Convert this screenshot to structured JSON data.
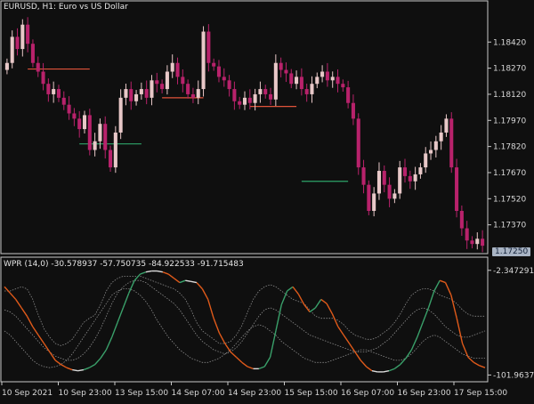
{
  "chart_data": [
    {
      "type": "candlestick",
      "symbol": "EURUSD",
      "timeframe": "H1",
      "description": "Euro vs US Dollar",
      "title_text": "EURUSD, H1:  Euro vs US Dollar",
      "y_ticks": [
        "1.18420",
        "1.18270",
        "1.18120",
        "1.17970",
        "1.17820",
        "1.17670",
        "1.17520",
        "1.17370"
      ],
      "current_price": "1.17250",
      "ylim": [
        1.1722,
        1.1859
      ],
      "closes": [
        1.183,
        1.1845,
        1.1838,
        1.1852,
        1.1841,
        1.183,
        1.1825,
        1.1818,
        1.1812,
        1.1815,
        1.181,
        1.1806,
        1.1801,
        1.1798,
        1.1792,
        1.18,
        1.178,
        1.1785,
        1.1795,
        1.178,
        1.177,
        1.179,
        1.181,
        1.1815,
        1.1808,
        1.1812,
        1.1815,
        1.181,
        1.182,
        1.1818,
        1.1815,
        1.1825,
        1.183,
        1.1822,
        1.1818,
        1.1812,
        1.181,
        1.1815,
        1.1848,
        1.183,
        1.1828,
        1.1822,
        1.182,
        1.1815,
        1.1808,
        1.1806,
        1.181,
        1.1807,
        1.1812,
        1.1815,
        1.1812,
        1.1809,
        1.183,
        1.1826,
        1.1824,
        1.1818,
        1.1822,
        1.1815,
        1.1812,
        1.1818,
        1.1822,
        1.1825,
        1.182,
        1.1822,
        1.1818,
        1.1816,
        1.1807,
        1.1798,
        1.177,
        1.176,
        1.1745,
        1.1755,
        1.1768,
        1.176,
        1.1752,
        1.1755,
        1.177,
        1.1765,
        1.1762,
        1.1766,
        1.177,
        1.1778,
        1.178,
        1.1785,
        1.179,
        1.1798,
        1.177,
        1.1745,
        1.1735,
        1.1728,
        1.1726,
        1.1729,
        1.1725
      ],
      "levels": [
        {
          "price": 1.18265,
          "color": "#e0533a",
          "start_bar": 4,
          "end_bar": 16
        },
        {
          "price": 1.17835,
          "color": "#2fa56a",
          "start_bar": 14,
          "end_bar": 26
        },
        {
          "price": 1.181,
          "color": "#e0533a",
          "start_bar": 30,
          "end_bar": 38
        },
        {
          "price": 1.1805,
          "color": "#e0533a",
          "start_bar": 47,
          "end_bar": 56
        },
        {
          "price": 1.1762,
          "color": "#2fa56a",
          "start_bar": 57,
          "end_bar": 66
        }
      ],
      "colors": {
        "bull": "#e8c8c8",
        "bear": "#b8226b",
        "current_bg": "#a9b4c4"
      }
    },
    {
      "type": "line",
      "name": "WPR (14,0)",
      "values_text": [
        "-30.578937",
        "-57.750735",
        "-84.922533",
        "-91.715483"
      ],
      "y_ticks": [
        "-2.347291",
        "-101.96374"
      ],
      "ylim": [
        -105,
        0
      ],
      "x_labels": [
        "10 Sep 2021",
        "10 Sep 23:00",
        "13 Sep 15:00",
        "14 Sep 07:00",
        "14 Sep 23:00",
        "15 Sep 15:00",
        "16 Sep 07:00",
        "16 Sep 23:00",
        "17 Sep 15:00"
      ],
      "series": [
        {
          "values": [
            -18,
            -24,
            -30,
            -38,
            -46,
            -56,
            -64,
            -72,
            -80,
            -88,
            -92,
            -95,
            -97,
            -98,
            -97,
            -95,
            -92,
            -86,
            -78,
            -66,
            -52,
            -38,
            -24,
            -12,
            -6,
            -4,
            -3,
            -3,
            -4,
            -6,
            -10,
            -14,
            -12,
            -13,
            -14,
            -20,
            -30,
            -48,
            -62,
            -72,
            -80,
            -85,
            -90,
            -94,
            -96,
            -96,
            -94,
            -85,
            -60,
            -35,
            -22,
            -18,
            -25,
            -35,
            -42,
            -38,
            -30,
            -34,
            -44,
            -56,
            -64,
            -72,
            -80,
            -88,
            -94,
            -98,
            -99,
            -99,
            -98,
            -96,
            -92,
            -86,
            -78,
            -66,
            -52,
            -38,
            -22,
            -12,
            -14,
            -26,
            -48,
            -72,
            -85,
            -90,
            -93,
            -95
          ]
        }
      ],
      "bands": [
        {
          "values": [
            -22,
            -22,
            -20,
            -18,
            -20,
            -30,
            -45,
            -58,
            -66,
            -72,
            -74,
            -72,
            -68,
            -60,
            -52,
            -48,
            -45,
            -35,
            -22,
            -14,
            -10,
            -8,
            -8,
            -8,
            -8,
            -10,
            -12,
            -14,
            -16,
            -18,
            -20,
            -24,
            -30,
            -40,
            -52,
            -60,
            -64,
            -68,
            -72,
            -72,
            -70,
            -64,
            -55,
            -42,
            -30,
            -22,
            -18,
            -16,
            -18,
            -22,
            -26,
            -30,
            -32,
            -34,
            -40,
            -46,
            -48,
            -48,
            -48,
            -50,
            -54,
            -60,
            -64,
            -66,
            -68,
            -68,
            -66,
            -62,
            -58,
            -52,
            -44,
            -34,
            -26,
            -22,
            -20,
            -20,
            -22,
            -26,
            -28,
            -30,
            -34,
            -40,
            -44,
            -46,
            -46,
            -46
          ]
        },
        {
          "values": [
            -40,
            -42,
            -46,
            -52,
            -58,
            -64,
            -70,
            -76,
            -80,
            -84,
            -86,
            -88,
            -88,
            -86,
            -82,
            -76,
            -68,
            -58,
            -46,
            -34,
            -24,
            -18,
            -14,
            -12,
            -12,
            -14,
            -18,
            -22,
            -26,
            -30,
            -34,
            -40,
            -48,
            -56,
            -64,
            -70,
            -74,
            -78,
            -80,
            -82,
            -80,
            -76,
            -70,
            -62,
            -54,
            -46,
            -40,
            -38,
            -40,
            -44,
            -48,
            -52,
            -56,
            -60,
            -64,
            -66,
            -68,
            -70,
            -72,
            -74,
            -76,
            -78,
            -80,
            -80,
            -80,
            -78,
            -76,
            -72,
            -68,
            -62,
            -56,
            -50,
            -44,
            -40,
            -38,
            -40,
            -44,
            -50,
            -56,
            -60,
            -64,
            -66,
            -66,
            -64,
            -62,
            -60
          ]
        },
        {
          "values": [
            -60,
            -64,
            -70,
            -76,
            -82,
            -88,
            -92,
            -94,
            -95,
            -94,
            -92,
            -88,
            -82,
            -74,
            -66,
            -58,
            -50,
            -42,
            -34,
            -26,
            -22,
            -20,
            -20,
            -22,
            -26,
            -32,
            -40,
            -50,
            -58,
            -66,
            -72,
            -78,
            -82,
            -86,
            -88,
            -90,
            -90,
            -88,
            -86,
            -82,
            -78,
            -72,
            -66,
            -60,
            -56,
            -54,
            -56,
            -60,
            -64,
            -70,
            -74,
            -78,
            -82,
            -86,
            -88,
            -90,
            -90,
            -90,
            -88,
            -86,
            -84,
            -82,
            -80,
            -78,
            -78,
            -80,
            -82,
            -84,
            -86,
            -88,
            -88,
            -86,
            -82,
            -76,
            -70,
            -66,
            -64,
            -66,
            -70,
            -74,
            -78,
            -82,
            -84,
            -86,
            -86,
            -86
          ]
        }
      ],
      "colors": {
        "up": "#3aa06a",
        "down": "#e05a1a",
        "flat": "#dcdcdc",
        "band": "#8a8a8a"
      }
    }
  ]
}
